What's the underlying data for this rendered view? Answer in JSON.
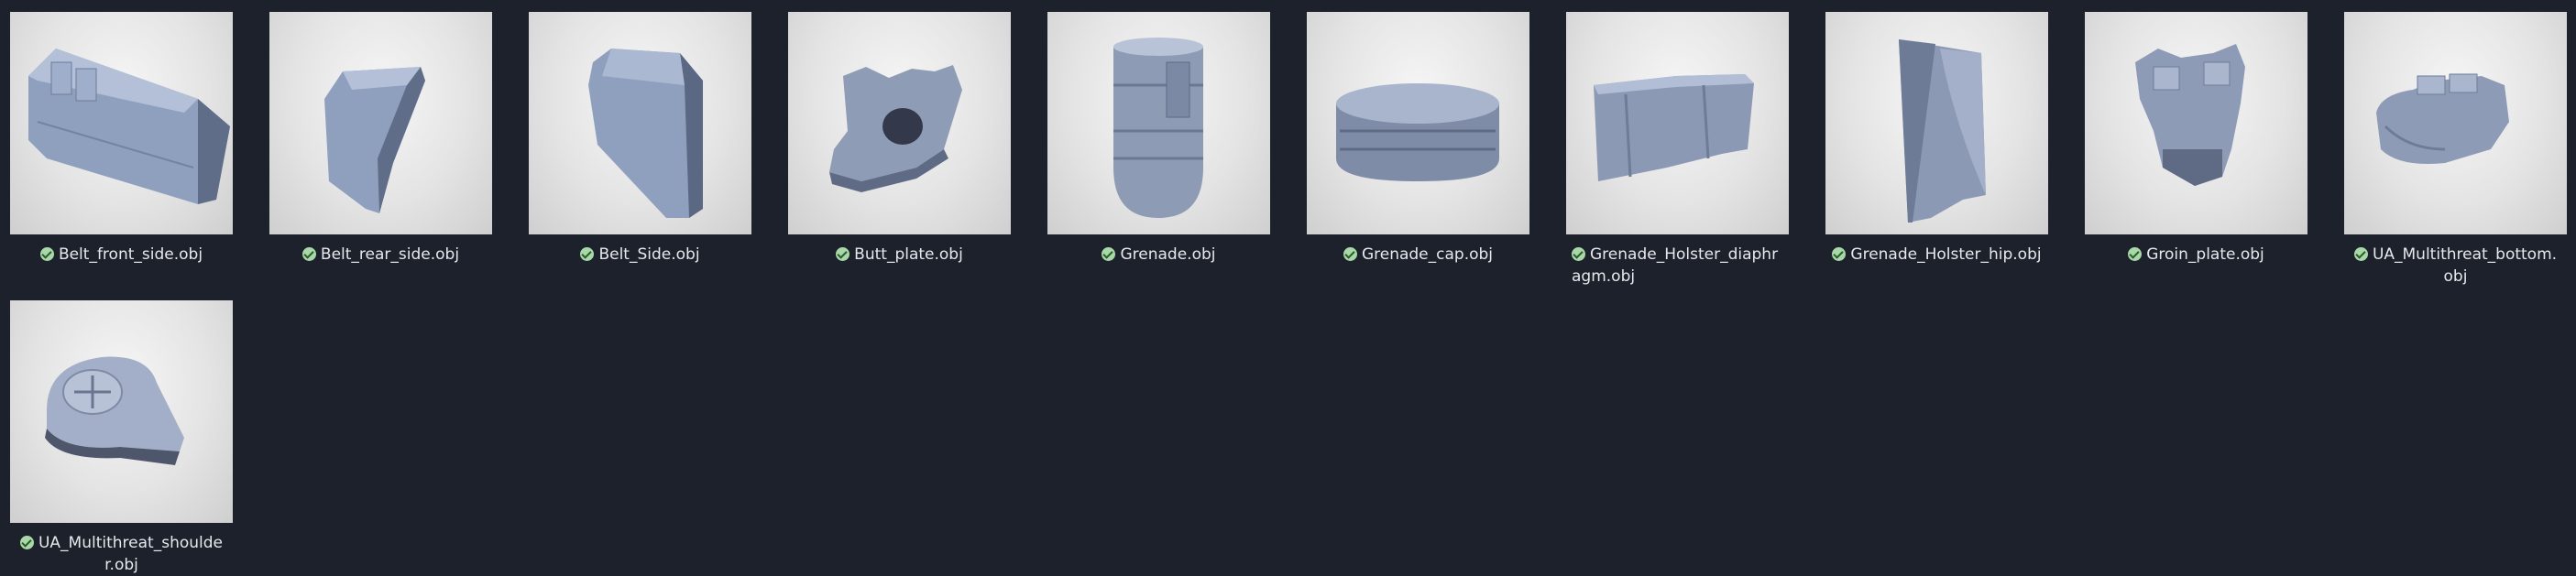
{
  "files": [
    {
      "name": "Belt_front_side.obj",
      "icon": "check-circle-icon"
    },
    {
      "name": "Belt_rear_side.obj",
      "icon": "check-circle-icon"
    },
    {
      "name": "Belt_Side.obj",
      "icon": "check-circle-icon"
    },
    {
      "name": "Butt_plate.obj",
      "icon": "check-circle-icon"
    },
    {
      "name": "Grenade.obj",
      "icon": "check-circle-icon"
    },
    {
      "name": "Grenade_cap.obj",
      "icon": "check-circle-icon"
    },
    {
      "name": "Grenade_Holster_diaphragm.obj",
      "icon": "check-circle-icon"
    },
    {
      "name": "Grenade_Holster_hip.obj",
      "icon": "check-circle-icon"
    },
    {
      "name": "Groin_plate.obj",
      "icon": "check-circle-icon"
    },
    {
      "name": "UA_Multithreat_bottom.obj",
      "icon": "check-circle-icon"
    },
    {
      "name": "UA_Multithreat_shoulder.obj",
      "icon": "check-circle-icon"
    }
  ],
  "colors": {
    "background": "#1c212b",
    "caption_text": "#e6e8ec",
    "status_ok": "#a8d8a8",
    "model": "#8c9bb8"
  }
}
